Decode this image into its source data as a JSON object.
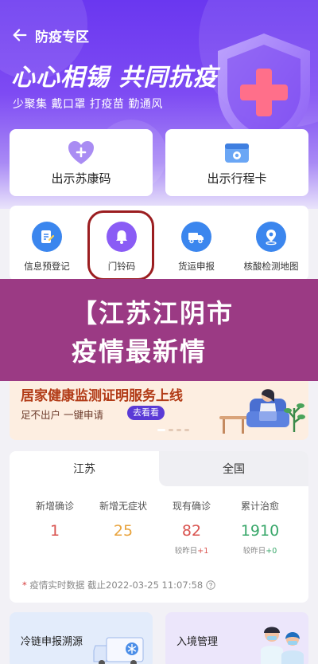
{
  "header": {
    "back_icon": "arrow-left-icon",
    "title": "防疫专区",
    "slogan": "心心相锡 共同抗疫",
    "subslogan": "少聚集 戴口罩 打疫苗 勤通风"
  },
  "quick_cards": [
    {
      "label": "出示苏康码",
      "icon": "health-code-heart-icon"
    },
    {
      "label": "出示行程卡",
      "icon": "itinerary-card-icon"
    }
  ],
  "services": [
    {
      "label": "信息预登记",
      "icon": "form-edit-icon"
    },
    {
      "label": "门铃码",
      "icon": "bell-icon"
    },
    {
      "label": "货运申报",
      "icon": "truck-icon"
    },
    {
      "label": "核酸检测地图",
      "icon": "map-pin-icon"
    }
  ],
  "headline": {
    "line1": "【江苏江阴市",
    "line2": "疫情最新情"
  },
  "promo": {
    "title": "居家健康监测证明服务上线",
    "subtitle": "足不出户  一键申请",
    "button": "去看看"
  },
  "stats": {
    "tabs": [
      "江苏",
      "全国"
    ],
    "metrics": [
      {
        "label": "新增确诊",
        "value": "1",
        "delta_prefix": "",
        "delta": "",
        "color": "#d9534f"
      },
      {
        "label": "新增无症状",
        "value": "25",
        "delta_prefix": "",
        "delta": "",
        "color": "#e8a33d"
      },
      {
        "label": "现有确诊",
        "value": "82",
        "delta_prefix": "较昨日",
        "delta": "+1",
        "color": "#d9534f"
      },
      {
        "label": "累计治愈",
        "value": "1910",
        "delta_prefix": "较昨日",
        "delta": "+0",
        "color": "#3aa86b"
      }
    ],
    "footnote": "疫情实时数据  截止2022-03-25 11:07:58",
    "help_icon": "question-circle-icon"
  },
  "bottom_cards": [
    {
      "label": "冷链申报溯源",
      "icon": "cold-chain-truck-icon"
    },
    {
      "label": "入境管理",
      "icon": "medical-staff-icon"
    }
  ]
}
